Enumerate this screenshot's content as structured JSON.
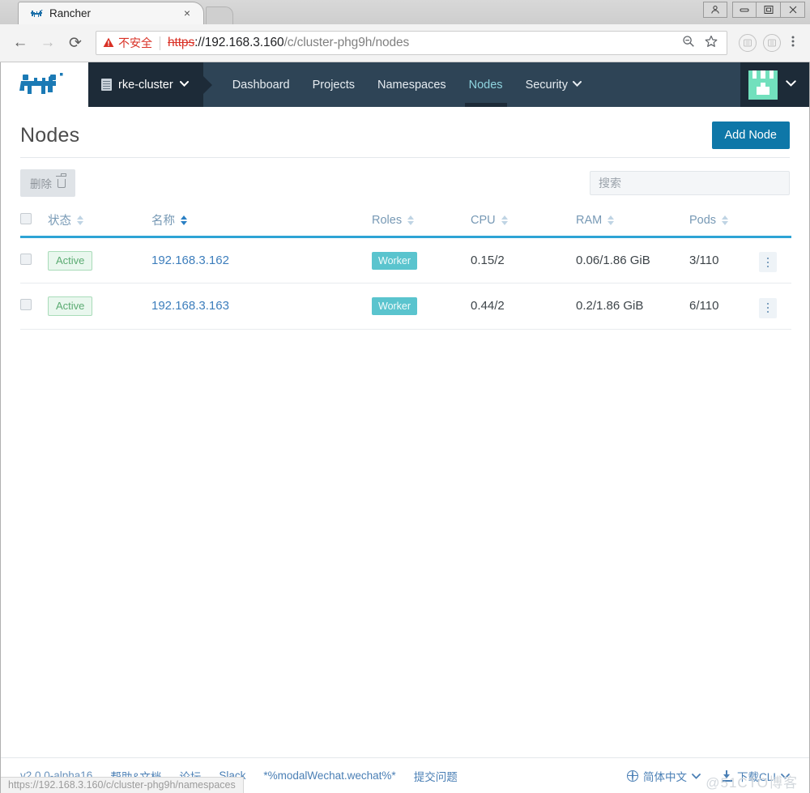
{
  "browser": {
    "tab": {
      "title": "Rancher",
      "favicon": "rancher-cow-icon",
      "close": "×"
    },
    "window_controls": {
      "profile": "profile-icon",
      "minimize": "–",
      "maximize": "▣",
      "close": "✕"
    },
    "nav": {
      "back": "←",
      "forward": "→",
      "reload": "⟳"
    },
    "omnibox": {
      "security_label": "不安全",
      "scheme": "https",
      "separator": "://",
      "host": "192.168.3.160",
      "path": "/c/cluster-phg9h/nodes",
      "zoom_icon": "search-minus-icon",
      "bookmark_icon": "star-icon",
      "extension_1": "extension-icon",
      "extension_2": "extension-icon",
      "menu_icon": "three-dot-menu-icon"
    },
    "status_bar_url": "https://192.168.3.160/c/cluster-phg9h/namespaces"
  },
  "app": {
    "logo": "rancher-logo",
    "cluster_selector": {
      "label": "rke-cluster",
      "icon": "cluster-list-icon",
      "caret": "⌄"
    },
    "nav_tabs": [
      {
        "label": "Dashboard",
        "active": false,
        "has_caret": false
      },
      {
        "label": "Projects",
        "active": false,
        "has_caret": false
      },
      {
        "label": "Namespaces",
        "active": false,
        "has_caret": false
      },
      {
        "label": "Nodes",
        "active": true,
        "has_caret": false
      },
      {
        "label": "Security",
        "active": false,
        "has_caret": true,
        "caret": "⌄"
      }
    ],
    "user_menu": {
      "avatar": "user-avatar-identicon",
      "caret": "⌄"
    }
  },
  "page": {
    "title": "Nodes",
    "add_button": "Add Node",
    "delete_button": "删除",
    "delete_icon": "trash-icon",
    "search_placeholder": "搜索",
    "search_value": ""
  },
  "table": {
    "columns": [
      {
        "label": "状态",
        "sorted": false
      },
      {
        "label": "名称",
        "sorted": true
      },
      {
        "label": "Roles",
        "sorted": false
      },
      {
        "label": "CPU",
        "sorted": false
      },
      {
        "label": "RAM",
        "sorted": false
      },
      {
        "label": "Pods",
        "sorted": false
      }
    ],
    "rows": [
      {
        "selected": false,
        "state": "Active",
        "name": "192.168.3.162",
        "role": "Worker",
        "cpu": "0.15/2",
        "ram": "0.06/1.86 GiB",
        "pods": "3/110",
        "menu": "row-actions-icon"
      },
      {
        "selected": false,
        "state": "Active",
        "name": "192.168.3.163",
        "role": "Worker",
        "cpu": "0.44/2",
        "ram": "0.2/1.86 GiB",
        "pods": "6/110",
        "menu": "row-actions-icon"
      }
    ]
  },
  "footer": {
    "version": "v2.0.0-alpha16",
    "links": [
      "帮助&文档",
      "论坛",
      "Slack",
      "*%modalWechat.wechat%*",
      "提交问题"
    ],
    "language": {
      "label": "简体中文",
      "icon": "globe-icon",
      "caret": "⌄"
    },
    "cli": {
      "label": "下载CLI",
      "icon": "download-icon",
      "caret": "⌄"
    }
  },
  "watermark": "@51CTO博客",
  "colors": {
    "accent_blue": "#0e77a8",
    "nav_dark": "#2e4456",
    "nav_darker": "#1d2b38",
    "active_tab": "#8fd4df",
    "table_underline": "#2ea4d5",
    "badge_active_text": "#5bab72",
    "badge_role_bg": "#5ac4ce",
    "link_blue": "#3d7ebc",
    "insecure_red": "#d93025"
  }
}
